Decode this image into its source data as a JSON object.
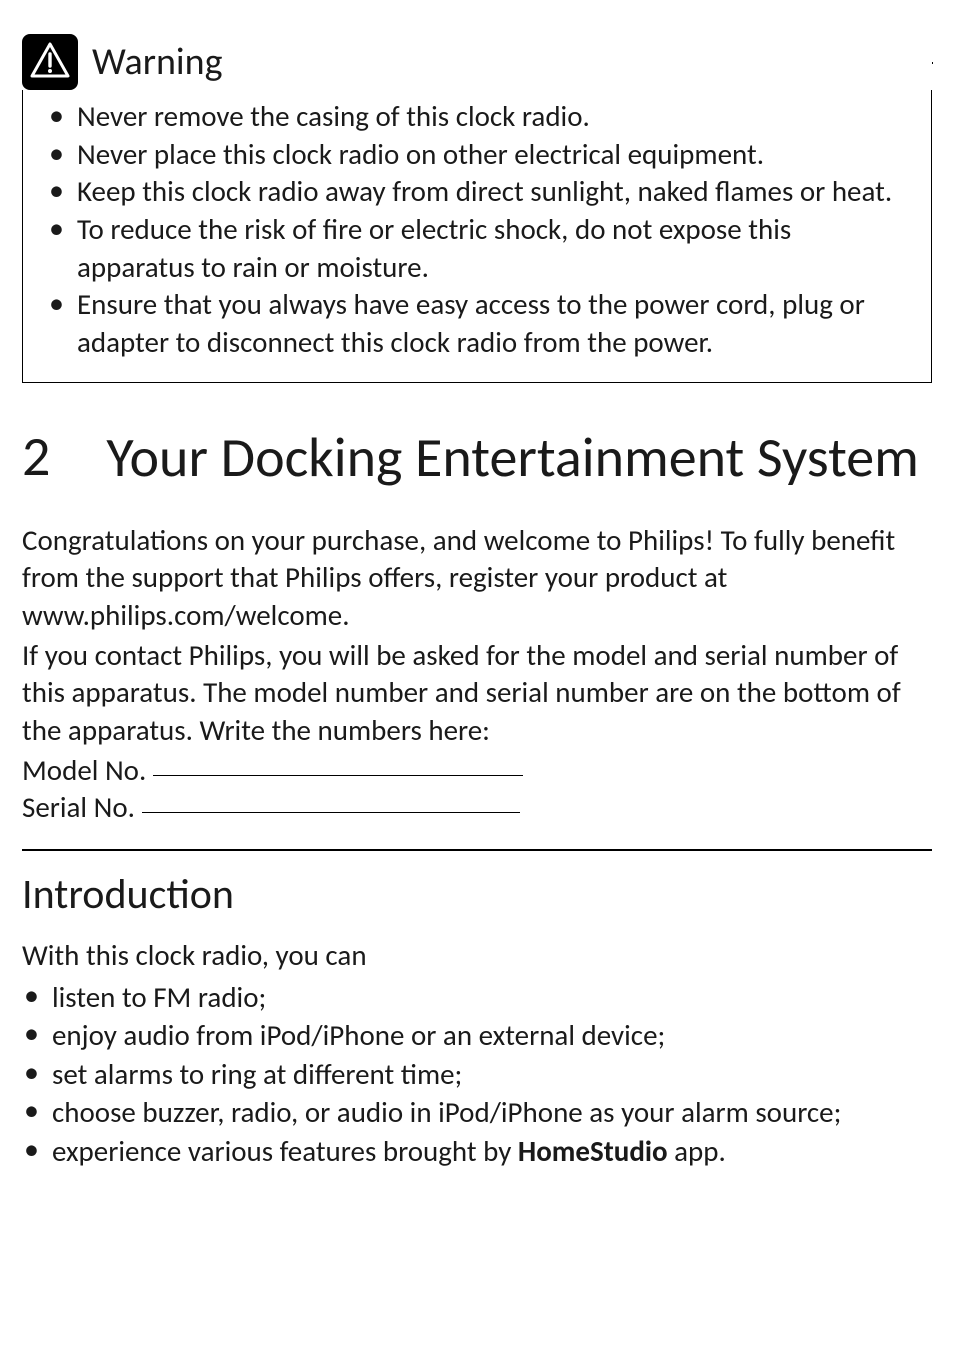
{
  "warning": {
    "title": "Warning",
    "items": [
      "Never remove the casing of this clock radio.",
      "Never place this clock radio on other electrical equipment.",
      "Keep this clock radio away from direct sunlight, naked flames or heat.",
      "To reduce the risk of fire or electric shock, do not expose this apparatus to rain or moisture.",
      "Ensure that you always have easy access to the power cord, plug or adapter to disconnect this clock radio from the power."
    ]
  },
  "section": {
    "number": "2",
    "title": "Your Docking Entertainment System",
    "para1": "Congratulations on your purchase, and welcome to Philips! To fully benefit from the support that Philips offers, register your product at www.philips.com/welcome.",
    "para2": "If you contact Philips, you will be asked for the model and serial number of this apparatus. The model number and serial number are on the bottom of the apparatus. Write the numbers here:",
    "model_label": "Model No.",
    "serial_label": "Serial No."
  },
  "introduction": {
    "heading": "Introduction",
    "lead": "With this clock radio, you can",
    "items": [
      "listen to FM radio;",
      "enjoy audio from iPod/iPhone or an external device;",
      "set alarms to ring at different time;",
      "choose buzzer, radio, or audio in iPod/iPhone as your alarm source;"
    ],
    "last_item_prefix": "experience various features brought by ",
    "last_item_bold": "HomeStudio",
    "last_item_suffix": " app."
  }
}
